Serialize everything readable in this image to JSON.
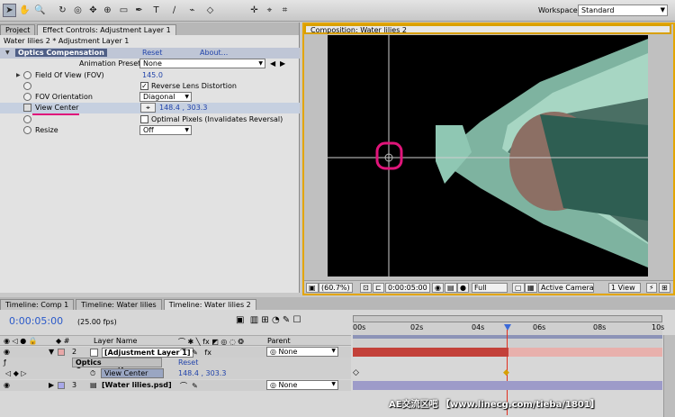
{
  "toolbar": {
    "workspace_label": "Workspace:",
    "workspace_value": "Standard"
  },
  "left_panel": {
    "tabs": [
      "Project",
      "Effect Controls: Adjustment Layer 1"
    ],
    "subtitle": "Water lilies 2 * Adjustment Layer 1",
    "effect_name": "Optics Compensation",
    "reset": "Reset",
    "about": "About...",
    "presets_label": "Animation Presets:",
    "presets_value": "None",
    "props": {
      "fov_label": "Field Of View (FOV)",
      "fov_value": "145.0",
      "reverse_label": "Reverse Lens Distortion",
      "orientation_label": "FOV Orientation",
      "orientation_value": "Diagonal",
      "viewcenter_label": "View Center",
      "viewcenter_value": "148.4 , 303.3",
      "optimal_label": "Optimal Pixels (Invalidates Reversal)",
      "resize_label": "Resize",
      "resize_value": "Off"
    }
  },
  "comp_panel": {
    "tab": "Composition: Water lilies 2",
    "zoom": "(60.7%)",
    "timecode": "0:00:05:00",
    "resolution": "Full",
    "camera": "Active Camera",
    "views": "1 View"
  },
  "timeline": {
    "tabs": [
      "Timeline: Comp 1",
      "Timeline: Water lilies",
      "Timeline: Water lilies 2"
    ],
    "current_time": "0:00:05:00",
    "fps": "(25.00 fps)",
    "header_name": "Layer Name",
    "header_parent": "Parent",
    "ruler": [
      "00s",
      "02s",
      "04s",
      "06s",
      "08s",
      "10s"
    ],
    "playhead_fraction": 0.5,
    "layers": [
      {
        "num": "2",
        "name": "[Adjustment Layer 1]",
        "parent": "None"
      },
      {
        "num": "3",
        "name": "[Water lilies.psd]",
        "parent": "None"
      }
    ],
    "effect_row": {
      "name": "Optics Compensation",
      "reset": "Reset"
    },
    "vc_row": {
      "name": "View Center",
      "value": "148.4 , 303.3"
    }
  },
  "watermark": "AE交流区吧 【www.linecg.com/tieba/1801】",
  "colors": {
    "comp_border": "#e3a500",
    "annotation": "#e0157a",
    "work_bar": "#c3413a",
    "layer_bar": "#9d9bc9",
    "timecode": "#2a59c9"
  }
}
